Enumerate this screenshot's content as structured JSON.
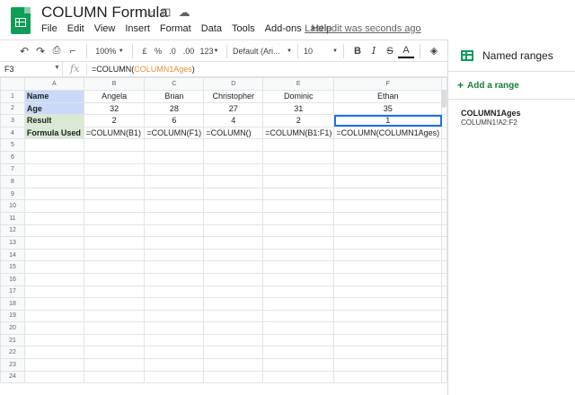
{
  "app": {
    "title": "COLUMN Formula",
    "menus": [
      "File",
      "Edit",
      "View",
      "Insert",
      "Format",
      "Data",
      "Tools",
      "Add-ons",
      "Help"
    ],
    "last_edit": "Last edit was seconds ago"
  },
  "toolbar": {
    "zoom": "100%",
    "currency": "£",
    "percent": "%",
    "decrease_decimal": ".0",
    "increase_decimal": ".00",
    "more_formats": "123",
    "font": "Default (Ari...",
    "font_size": "10",
    "bold": "B",
    "italic": "I",
    "strike": "S",
    "text_color": "A"
  },
  "formula_bar": {
    "cell_ref": "F3",
    "fx": "fx",
    "formula_prefix": "=COLUMN(",
    "formula_ref": "COLUMN1Ages",
    "formula_suffix": ")"
  },
  "sheet": {
    "columns": [
      "A",
      "B",
      "C",
      "D",
      "E",
      "F"
    ],
    "selected_cell": "F3",
    "rows": [
      [
        "Name",
        "Angela",
        "Brian",
        "Christopher",
        "Dominic",
        "Ethan"
      ],
      [
        "Age",
        "32",
        "28",
        "27",
        "31",
        "35"
      ],
      [
        "Result",
        "2",
        "6",
        "4",
        "2",
        "1"
      ],
      [
        "Formula Used",
        "=COLUMN(B1)",
        "=COLUMN(F1)",
        "=COLUMN()",
        "=COLUMN(B1:F1)",
        "=COLUMN(COLUMN1Ages)"
      ]
    ],
    "row_numbers": [
      "1",
      "2",
      "3",
      "4",
      "5",
      "6",
      "7",
      "8",
      "9",
      "10",
      "11",
      "12",
      "13",
      "14",
      "15",
      "16",
      "17",
      "18",
      "19",
      "20",
      "21",
      "22",
      "23",
      "24"
    ]
  },
  "panel": {
    "title": "Named ranges",
    "add_label": "Add a range",
    "ranges": [
      {
        "name": "COLUMN1Ages",
        "ref": "COLUMN1!A2:F2"
      }
    ]
  },
  "colors": {
    "label_blue": "#c9daf8",
    "label_green": "#d9ead3",
    "accent": "#1a73e8",
    "brand": "#0f9d58"
  }
}
